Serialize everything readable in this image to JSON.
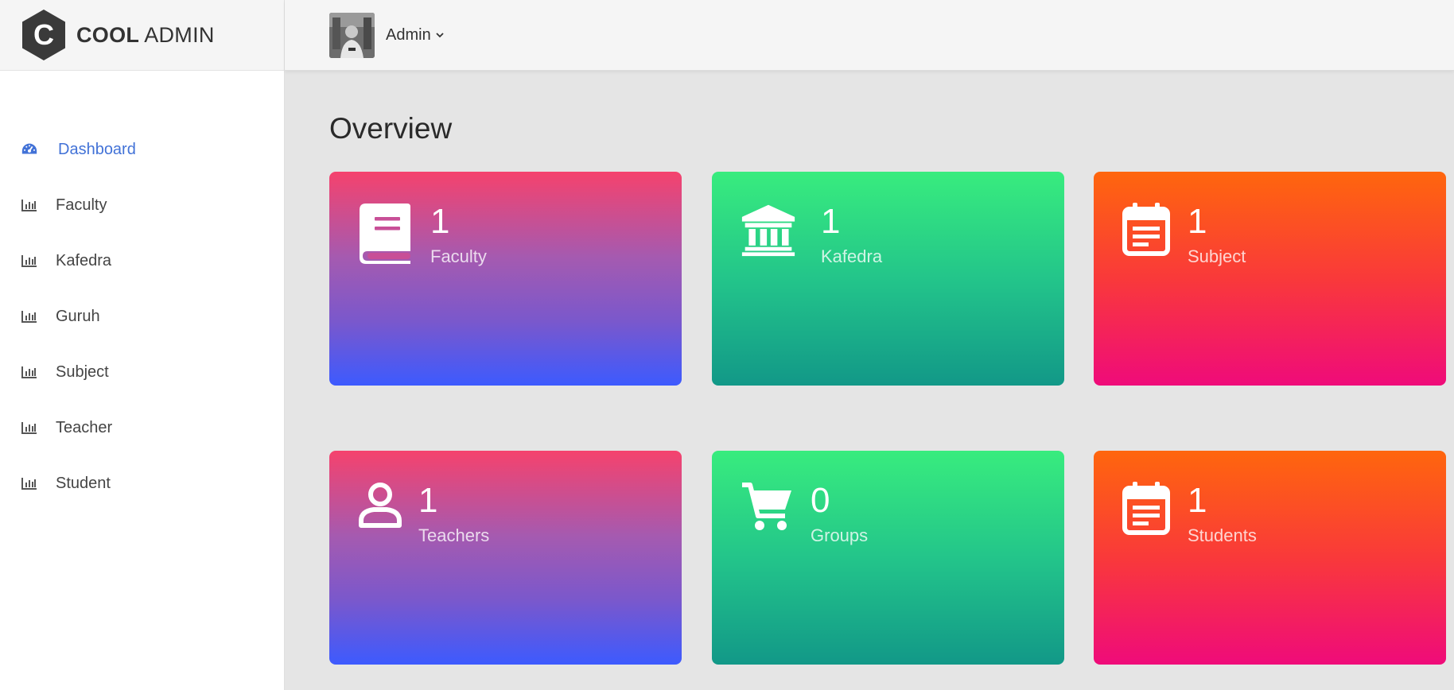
{
  "brand": {
    "bold": "COOL",
    "thin": "ADMIN",
    "letter": "C"
  },
  "header": {
    "user_name": "Admin"
  },
  "sidebar": {
    "items": [
      {
        "label": "Dashboard",
        "icon": "dashboard-icon",
        "active": true
      },
      {
        "label": "Faculty",
        "icon": "bar-chart-icon"
      },
      {
        "label": "Kafedra",
        "icon": "bar-chart-icon"
      },
      {
        "label": "Guruh",
        "icon": "bar-chart-icon"
      },
      {
        "label": "Subject",
        "icon": "bar-chart-icon"
      },
      {
        "label": "Teacher",
        "icon": "bar-chart-icon"
      },
      {
        "label": "Student",
        "icon": "bar-chart-icon"
      }
    ]
  },
  "main": {
    "title": "Overview",
    "cards": [
      {
        "count": "1",
        "label": "Faculty",
        "icon": "book-icon",
        "theme": "purple"
      },
      {
        "count": "1",
        "label": "Kafedra",
        "icon": "institution-icon",
        "theme": "green"
      },
      {
        "count": "1",
        "label": "Subject",
        "icon": "calendar-note-icon",
        "theme": "orange"
      },
      {
        "count": "1",
        "label": "Teachers",
        "icon": "person-icon",
        "theme": "purple"
      },
      {
        "count": "0",
        "label": "Groups",
        "icon": "cart-icon",
        "theme": "green"
      },
      {
        "count": "1",
        "label": "Students",
        "icon": "calendar-note-icon",
        "theme": "orange"
      }
    ]
  },
  "colors": {
    "accent": "#4272d7",
    "purple_gradient": [
      "#f5426d",
      "#3d5afe"
    ],
    "green_gradient": [
      "#38ec7e",
      "#129888"
    ],
    "orange_gradient": [
      "#ff660d",
      "#ef0b7a"
    ]
  }
}
